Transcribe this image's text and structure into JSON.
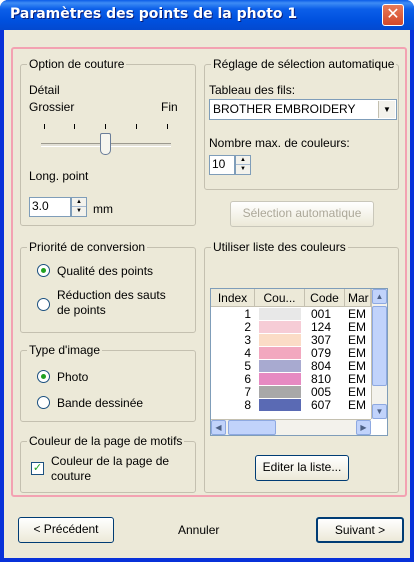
{
  "window": {
    "title": "Paramètres des points de la photo 1"
  },
  "stitch_option": {
    "legend": "Option de couture",
    "detail_label": "Détail",
    "coarse_label": "Grossier",
    "fine_label": "Fin",
    "detail_level": 0.5,
    "stitch_length_label": "Long. point",
    "stitch_length_value": "3.0",
    "unit": "mm"
  },
  "auto_select": {
    "legend": "Réglage de sélection automatique",
    "thread_chart_label": "Tableau des fils:",
    "thread_chart_value": "BROTHER EMBROIDERY",
    "max_colors_label": "Nombre max. de couleurs:",
    "max_colors_value": "10",
    "auto_button": "Sélection automatique"
  },
  "conversion_priority": {
    "legend": "Priorité de conversion",
    "options": [
      "Qualité des points",
      "Réduction des sauts de points"
    ],
    "selected": 0
  },
  "image_type": {
    "legend": "Type d'image",
    "options": [
      "Photo",
      "Bande dessinée"
    ],
    "selected": 0
  },
  "pattern_page_color": {
    "legend": "Couleur de la page de motifs",
    "checkbox_label": "Couleur de la page de couture",
    "checked": true
  },
  "color_list": {
    "legend": "Utiliser liste des couleurs",
    "columns": [
      "Index",
      "Cou...",
      "Code",
      "Mar"
    ],
    "rows": [
      {
        "index": "1",
        "color": "#e8e8e8",
        "code": "001",
        "brand": "EM"
      },
      {
        "index": "2",
        "color": "#f6ccd6",
        "code": "124",
        "brand": "EM"
      },
      {
        "index": "3",
        "color": "#fbdcc6",
        "code": "307",
        "brand": "EM"
      },
      {
        "index": "4",
        "color": "#f2a8bf",
        "code": "079",
        "brand": "EM"
      },
      {
        "index": "5",
        "color": "#a8aad0",
        "code": "804",
        "brand": "EM"
      },
      {
        "index": "6",
        "color": "#e68ac2",
        "code": "810",
        "brand": "EM"
      },
      {
        "index": "7",
        "color": "#a8a8a8",
        "code": "005",
        "brand": "EM"
      },
      {
        "index": "8",
        "color": "#5a6ab4",
        "code": "607",
        "brand": "EM"
      }
    ],
    "edit_button": "Editer la liste..."
  },
  "footer": {
    "previous": "< Précédent",
    "cancel": "Annuler",
    "next": "Suivant >"
  }
}
